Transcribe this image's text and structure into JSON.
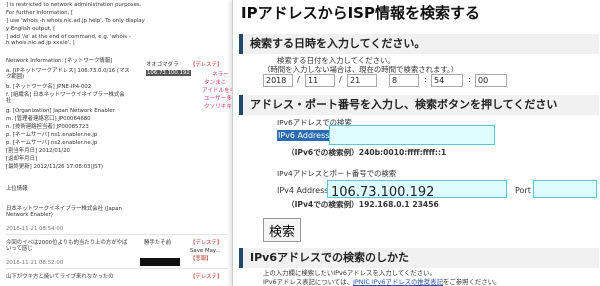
{
  "background": {
    "lines": [
      "] is restricted to network administration purposes.",
      "For further information, [",
      "] use 'whois -h whois.nic.ad.jp help'. To only display",
      "y English output, [",
      "] add '/e' at the end of command, e.g. 'whois -h whois.nic.ad.jp xxx/e'. ]",
      "Network Information: [ネットワーク情報]",
      "a. [IPネットワークアドレス] 106.73.0.0/16 (マスク範囲)",
      "b. [ネットワーク名] JPNE-IP4-002",
      "f. [組織名] 日本ネットワークイネイブラー株式会社",
      "g. [Organization] Japan Network Enabler",
      "m. [管理者連絡窓口] JP00064680",
      "n. [技術連絡担当者] JP00085723",
      "p. [ネームサーバ] ns1.enabler.ne.jp",
      "p. [ネームサーバ] ns2.enabler.ne.jp",
      "[割当年月日] 2012/01/20",
      "[返却年月日]",
      "[最終更新] 2012/11/26 17:08:03(JST)",
      "上位情報",
      "日本ネットワークイネイブラー株式会社 (Japan Network Enabler)",
      "2018-11-21 08:54:00",
      "今回のイベは2000位よりも的当たり上の方がやばいって感じ",
      "2018-11-21 08:52:00",
      "山下がウキ方と焼いてライブ来れなかったの"
    ],
    "middle": {
      "org_short": "オオゴマダラ",
      "ip_chip": "106.73.100.192",
      "link_1": "【デレステ】",
      "link_2": "【デレステ】",
      "link_3": "【デレステ】",
      "name_row": "勝手たそ前",
      "side_text": "Save May...",
      "side_text2": "【悲報】"
    },
    "pink_snippets": [
      "ネラー",
      "タンまこ",
      "アイドルをキャ",
      "ユーザー多く",
      "クソリキキ"
    ]
  },
  "popup": {
    "title": "IPアドレスからISP情報を検索する",
    "sections": {
      "datetime": "検索する日時を入力してください。",
      "address": "アドレス・ポート番号を入力し、検索ボタンを押してください",
      "ipv6_how": "IPv6アドレスでの検索のしかた"
    },
    "datetime_help": "検索する日付を入力してください。",
    "datetime_help2": "（時間を入力しない場合は、現在の時間で検索されます。）",
    "date": {
      "year": "2018",
      "month": "11",
      "day": "21",
      "hour": "8",
      "minute": "54",
      "second": "00"
    },
    "ipv6": {
      "group_label": "IPv6アドレスでの検索",
      "field_label": "IPv6 Address",
      "value": "",
      "example": "（IPv6での検索例）240b:0010:ffff:ffff::1"
    },
    "ipv4": {
      "group_label": "IPv4アドレスとポート番号での検索",
      "field_label": "IPv4 Address",
      "value": "106.73.100.192",
      "port_label": "Port",
      "port_value": "",
      "example": "（IPv4での検索例）192.168.0.1 23456"
    },
    "search_button": "検索",
    "footer_line1": "上の入力欄に検索したいIPv6アドレスを入力してください。",
    "footer_line2a": "IPv6アドレス表記については、",
    "footer_line2b": "JPNIC IPv6アドレスの推奨表記",
    "footer_line2c": "をご参照ください。",
    "colors": {
      "accent": "#23466d",
      "input_bg": "#dffcff",
      "input_border": "#58c7d8",
      "highlight": "#2b6cb0"
    }
  }
}
